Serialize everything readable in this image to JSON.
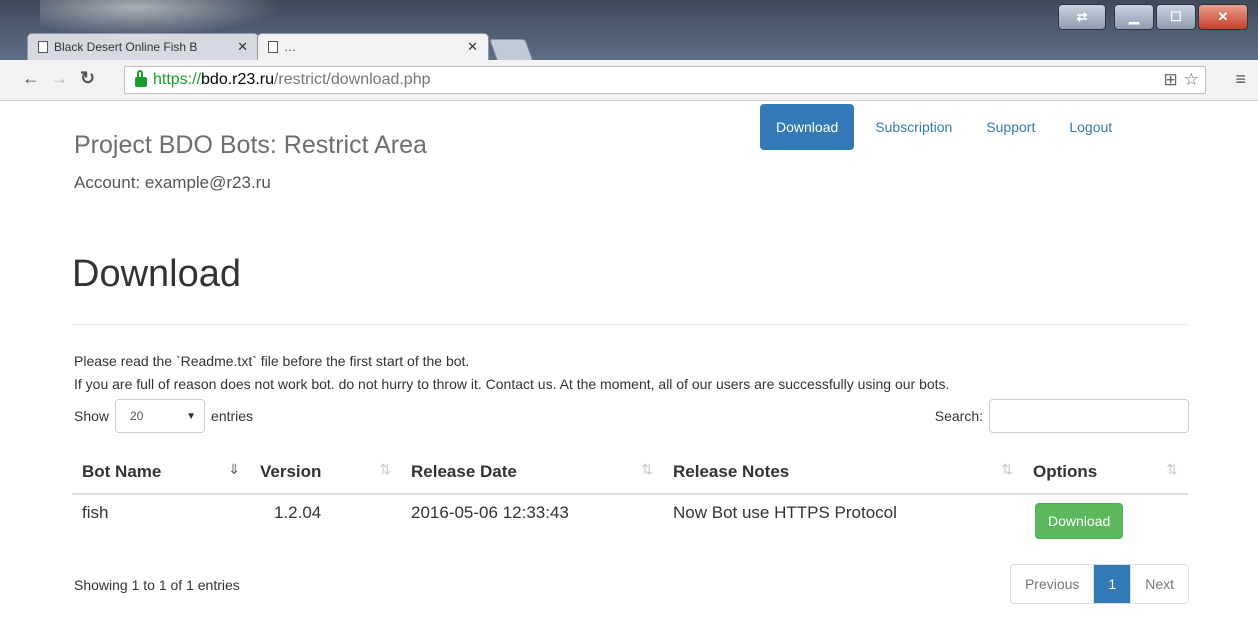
{
  "browser": {
    "tabs": [
      {
        "label": "Black Desert Online Fish B"
      },
      {
        "label": "…"
      }
    ],
    "url": {
      "scheme": "https://",
      "host": "bdo.r23.ru",
      "path": "/restrict/download.php"
    }
  },
  "site": {
    "brand": "Project BDO Bots: Restrict Area",
    "account": "Account: example@r23.ru",
    "nav": [
      "Download",
      "Subscription",
      "Support",
      "Logout"
    ],
    "active_nav": "Download"
  },
  "main": {
    "heading": "Download",
    "notes": [
      "Please read the `Readme.txt` file before the first start of the bot.",
      "If you are full of reason does not work bot. do not hurry to throw it. Contact us. At the moment, all of our users are successfully using our bots."
    ],
    "show_label": "Show",
    "entries_value": "20",
    "entries_label": "entries",
    "search_label": "Search:",
    "search_value": ""
  },
  "table": {
    "columns": [
      "Bot Name",
      "Version",
      "Release Date",
      "Release Notes",
      "Options"
    ],
    "rows": [
      {
        "name": "fish",
        "version": "1.2.04",
        "date": "2016-05-06 12:33:43",
        "notes": "Now Bot use HTTPS Protocol",
        "action": "Download"
      }
    ]
  },
  "footer": {
    "info": "Showing 1 to 1 of 1 entries",
    "pager": {
      "prev": "Previous",
      "current": "1",
      "next": "Next"
    }
  },
  "colors": {
    "primary": "#337ab7",
    "success": "#5cb85c"
  },
  "icons": [
    "back-arrow-icon",
    "forward-arrow-icon",
    "reload-icon",
    "lock-icon",
    "translate-icon",
    "star-icon",
    "menu-icon",
    "sort-icon",
    "document-icon"
  ]
}
